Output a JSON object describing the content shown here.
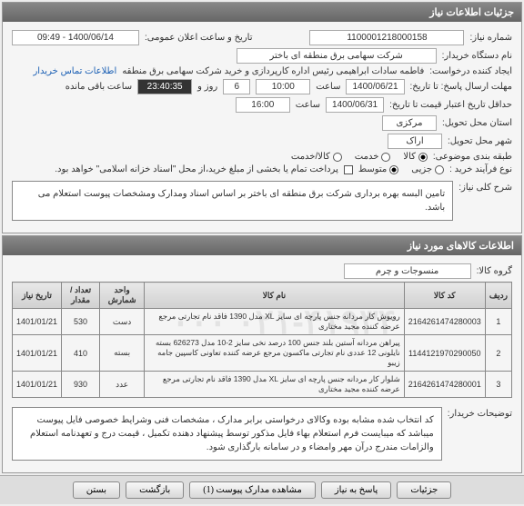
{
  "panel1_title": "جزئیات اطلاعات نیاز",
  "req_no_label": "شماره نیاز:",
  "req_no": "1100001218000158",
  "announce_label": "تاریخ و ساعت اعلان عمومی:",
  "announce_val": "1400/06/14 - 09:49",
  "buyer_label": "نام دستگاه خریدار:",
  "buyer_val": "شرکت سهامی برق منطقه ای باختر",
  "creator_label": "ایجاد کننده درخواست:",
  "creator_val": "فاطمه سادات ابراهیمی رئیس اداره کارپردازی و خرید شرکت سهامی برق منطقه",
  "contact_link": "اطلاعات تماس خریدار",
  "deadline_label": "مهلت ارسال پاسخ: تا تاریخ:",
  "deadline_date": "1400/06/21",
  "time_label": "ساعت",
  "deadline_time": "10:00",
  "days_val": "6",
  "days_suffix": "روز و",
  "countdown": "23:40:35",
  "remain_suffix": "ساعت باقی مانده",
  "validity_label": "حداقل تاریخ اعتبار قیمت تا تاریخ:",
  "validity_date": "1400/06/31",
  "validity_time": "16:00",
  "province_label": "استان محل تحویل:",
  "province_val": "مرکزی",
  "city_label": "شهر محل تحویل:",
  "city_val": "اراک",
  "category_label": "طبقه بندی موضوعی:",
  "cat_goods": "کالا",
  "cat_service": "خدمت",
  "cat_both": "کالا/خدمت",
  "process_label": "نوع فرآیند خرید :",
  "proc_small": "جزیی",
  "proc_med": "متوسط",
  "pay_note": "پرداخت تمام یا بخشی از مبلغ خرید،از محل \"اسناد خزانه اسلامی\" خواهد بود.",
  "need_title_label": "شرح کلی نیاز:",
  "need_title": "تامین البسه بهره برداری شرکت برق منطقه ای باختر بر اساس اسناد ومدارک ومشخصات پیوست استعلام می باشد.",
  "panel2_title": "اطلاعات کالاهای مورد نیاز",
  "group_label": "گروه کالا:",
  "group_val": "منسوجات و چرم",
  "columns": {
    "row": "ردیف",
    "code": "کد کالا",
    "name": "نام کالا",
    "unit": "واحد شمارش",
    "qty": "تعداد / مقدار",
    "date": "تاریخ نیاز"
  },
  "items": [
    {
      "row": "1",
      "code": "2164261474280003",
      "name": "رویوش کار مردانه جنس پارچه ای سایز XL مدل 1390 فاقد نام تجارتی مرجع عرضه کننده مجید مختاری",
      "unit": "دست",
      "qty": "530",
      "date": "1401/01/21"
    },
    {
      "row": "2",
      "code": "1144121970290050",
      "name": "پیراهن مردانه آستین بلند جنس 100 درصد نخی سایز 2-10 مدل 626273 بسته نایلونی 12 عددی نام تجارتی ماکسون مرجع عرضه کننده تعاونی کاسپین جامه زیبو",
      "unit": "بسته",
      "qty": "410",
      "date": "1401/01/21"
    },
    {
      "row": "3",
      "code": "2164261474280001",
      "name": "شلوار کار مردانه جنس پارچه ای سایز XL مدل 1390 فاقد نام تجارتی مرجع عرضه کننده مجید مختاری",
      "unit": "عدد",
      "qty": "930",
      "date": "1401/01/21"
    }
  ],
  "buyer_notes_label": "توضیحات خریدار:",
  "buyer_notes": "کد انتخاب شده مشابه بوده وکالای درخواستی برابر مدارک ، مشخصات فنی وشرایط خصوصی فایل پیوست میباشد که میبایست فرم استعلام بهاء فایل مذکور توسط پیشنهاد دهنده تکمیل ، قیمت درج و تعهدنامه استعلام والزامات  مندرج درآن مهر وامضاء و در سامانه بارگذاری شود.",
  "footer": {
    "close": "بستن",
    "back": "بازگشت",
    "attach": "مشاهده مدارک پیوست (1)",
    "reply": "پاسخ به نیاز",
    "detail": "جزئیات"
  },
  "watermark": "۰۲۱-۴۱۹۳۴ ۰۰۰"
}
